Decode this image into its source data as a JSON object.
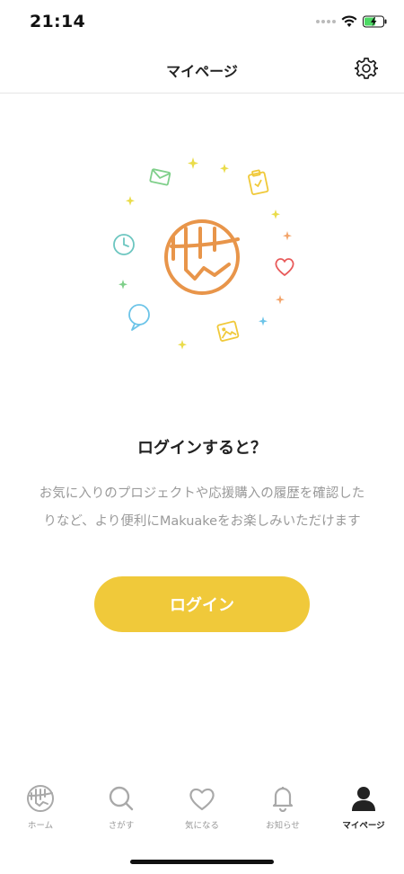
{
  "status_bar": {
    "time": "21:14"
  },
  "header": {
    "title": "マイページ"
  },
  "main": {
    "heading": "ログインすると？",
    "description_line1": "お気に入りのプロジェクトや応援購入の履歴を確認した",
    "description_line2": "りなど、より便利にMakuakeをお楽しみいただけます",
    "login_label": "ログイン"
  },
  "tabs": [
    {
      "label": "ホーム",
      "icon": "makuake-logo-icon",
      "active": false
    },
    {
      "label": "さがす",
      "icon": "search-icon",
      "active": false
    },
    {
      "label": "気になる",
      "icon": "heart-icon",
      "active": false
    },
    {
      "label": "お知らせ",
      "icon": "bell-icon",
      "active": false
    },
    {
      "label": "マイページ",
      "icon": "person-icon",
      "active": true
    }
  ],
  "colors": {
    "accent": "#f0c93a",
    "logo_orange": "#e8954a",
    "tab_active": "#222222",
    "tab_inactive": "#999999"
  }
}
